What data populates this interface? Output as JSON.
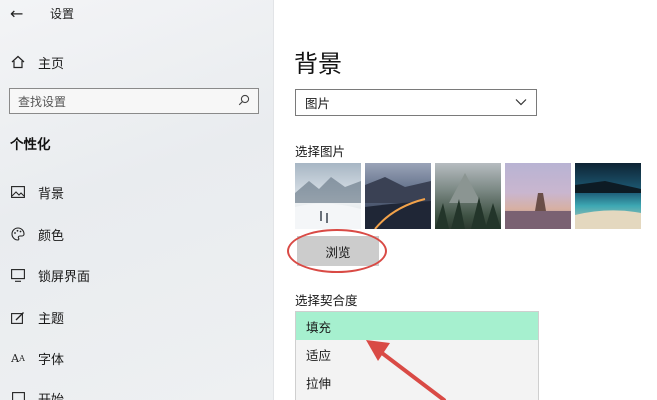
{
  "window": {
    "title": "设置"
  },
  "sidebar": {
    "home_label": "主页",
    "search_placeholder": "查找设置",
    "section_title": "个性化",
    "items": [
      {
        "label": "背景",
        "icon": "image-icon"
      },
      {
        "label": "颜色",
        "icon": "palette-icon"
      },
      {
        "label": "锁屏界面",
        "icon": "lock-screen-icon"
      },
      {
        "label": "主题",
        "icon": "theme-icon"
      },
      {
        "label": "字体",
        "icon": "font-icon"
      },
      {
        "label": "开始",
        "icon": "start-icon"
      }
    ]
  },
  "main": {
    "page_title": "背景",
    "background_select": {
      "value": "图片"
    },
    "choose_picture_label": "选择图片",
    "browse_label": "浏览",
    "fit_label": "选择契合度",
    "fit_options": [
      {
        "label": "填充",
        "selected": true
      },
      {
        "label": "适应",
        "selected": false
      },
      {
        "label": "拉伸",
        "selected": false
      }
    ]
  },
  "colors": {
    "selected_option": "#a6f0cf",
    "annotation": "#d94a45",
    "browse_button": "#cccccc"
  }
}
